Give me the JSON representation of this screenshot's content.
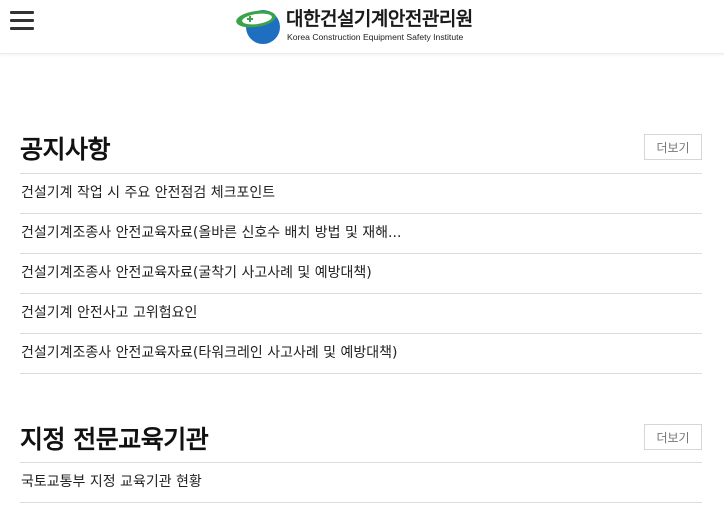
{
  "header": {
    "logo_title": "대한건설기계안전관리원",
    "logo_subtitle": "Korea Construction Equipment Safety Institute",
    "logo_colors": {
      "blue": "#1e6fbf",
      "green": "#3aa34a"
    },
    "menu_icon": "hamburger-menu-icon"
  },
  "notice": {
    "title": "공지사항",
    "more_label": "더보기",
    "items": [
      "건설기계 작업 시 주요 안전점검 체크포인트",
      "건설기계조종사 안전교육자료(올바른 신호수 배치 방법 및 재해...",
      "건설기계조종사 안전교육자료(굴착기 사고사례 및 예방대책)",
      "건설기계 안전사고 고위험요인",
      "건설기계조종사 안전교육자료(타워크레인 사고사례 및 예방대책)"
    ]
  },
  "institutions": {
    "title": "지정 전문교육기관",
    "more_label": "더보기",
    "items": [
      "국토교통부 지정 교육기관 현황"
    ]
  }
}
